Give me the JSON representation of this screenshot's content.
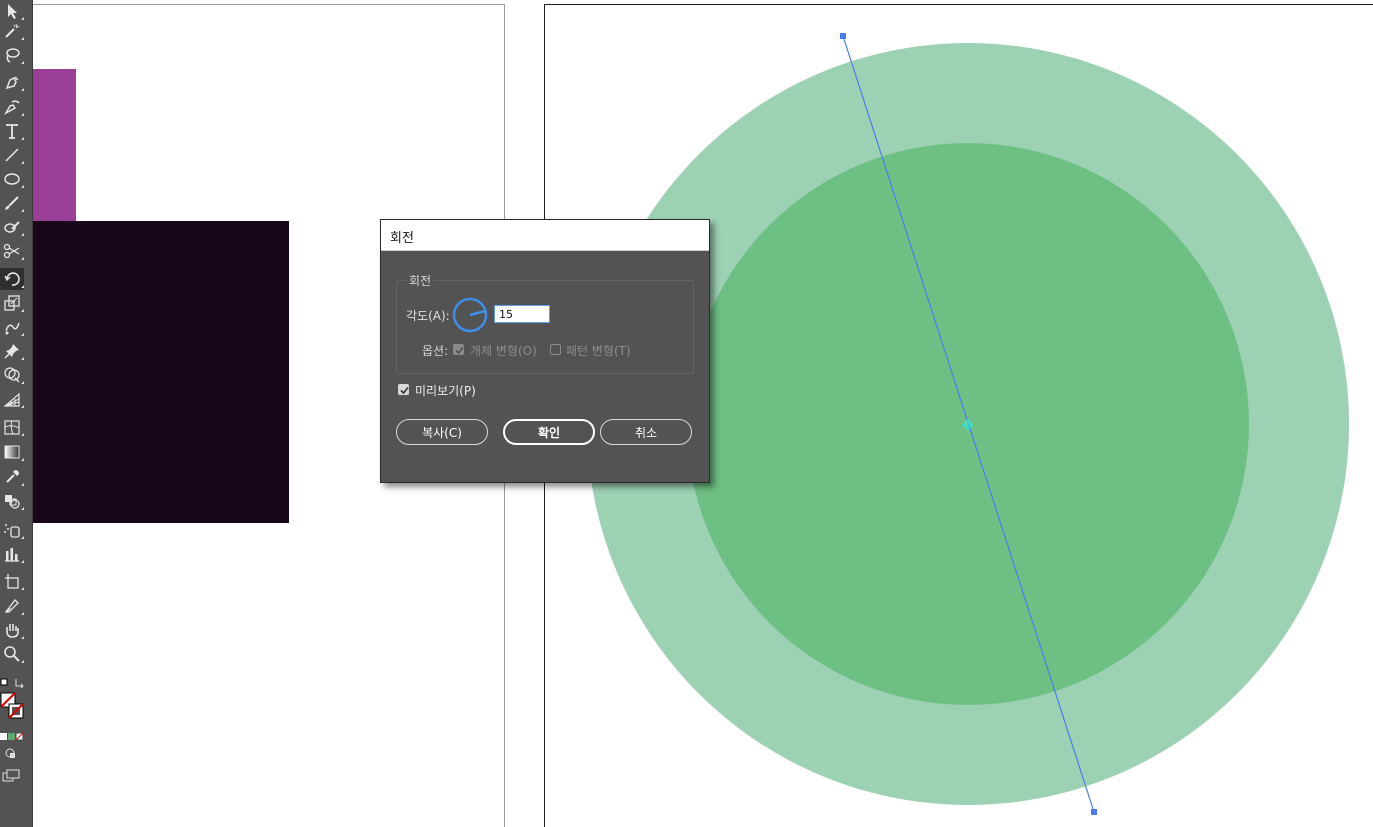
{
  "tools": [
    {
      "name": "direct-selection-tool-icon"
    },
    {
      "name": "magic-wand-tool-icon"
    },
    {
      "name": "lasso-tool-icon"
    },
    {
      "name": "pen-tool-icon"
    },
    {
      "name": "curvature-tool-icon"
    },
    {
      "name": "type-tool-icon"
    },
    {
      "name": "line-segment-tool-icon"
    },
    {
      "name": "ellipse-tool-icon"
    },
    {
      "name": "paintbrush-tool-icon"
    },
    {
      "name": "shaper-tool-icon"
    },
    {
      "name": "scissors-tool-icon"
    },
    {
      "name": "rotate-tool-icon",
      "active": true
    },
    {
      "name": "scale-tool-icon"
    },
    {
      "name": "puppet-warp-tool-icon"
    },
    {
      "name": "pin-tool-icon"
    },
    {
      "name": "shape-builder-tool-icon"
    },
    {
      "name": "perspective-grid-tool-icon"
    },
    {
      "name": "mesh-tool-icon"
    },
    {
      "name": "gradient-tool-icon"
    },
    {
      "name": "eyedropper-tool-icon"
    },
    {
      "name": "blend-tool-icon"
    },
    {
      "name": "symbol-sprayer-tool-icon"
    },
    {
      "name": "column-graph-tool-icon"
    },
    {
      "name": "artboard-tool-icon"
    },
    {
      "name": "slice-tool-icon"
    },
    {
      "name": "hand-tool-icon"
    },
    {
      "name": "zoom-tool-icon"
    }
  ],
  "colors": {
    "purple_shape": "#9a3f95",
    "dark_shape": "#1a0619",
    "outer_circle": "#9dd1b4",
    "inner_circle": "#6ebf84",
    "rotation_axis": "#4a7cf0",
    "center_marker": "#30e8e0"
  },
  "dialog": {
    "title": "회전",
    "group_label": "회전",
    "angle_label": "각도(A):",
    "angle_value": "15",
    "options_label": "옵션:",
    "transform_objects_label": "개체 변형(O)",
    "transform_objects_checked": true,
    "transform_patterns_label": "패턴 변형(T)",
    "transform_patterns_checked": false,
    "preview_label": "미리보기(P)",
    "preview_checked": true,
    "copy_button": "복사(C)",
    "ok_button": "확인",
    "cancel_button": "취소"
  }
}
